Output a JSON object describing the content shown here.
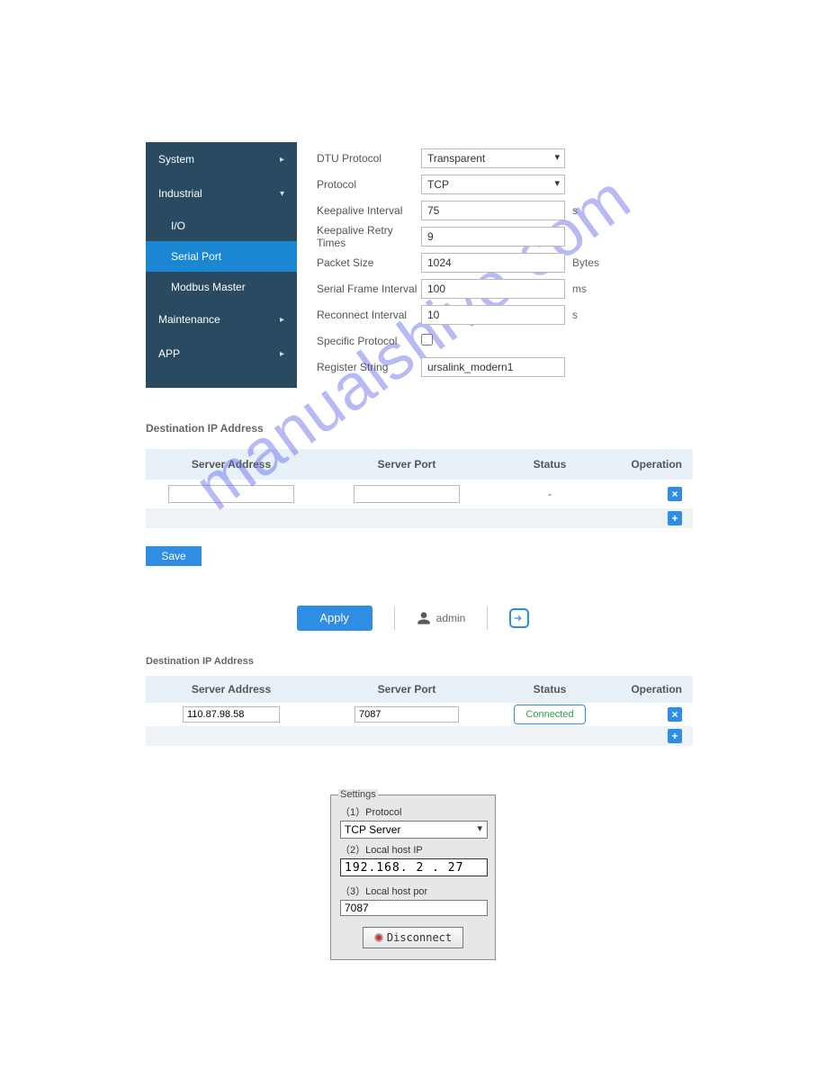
{
  "watermark": "manualshive.com",
  "sidebar": {
    "system": "System",
    "industrial": "Industrial",
    "io": "I/O",
    "serial_port": "Serial Port",
    "modbus_master": "Modbus Master",
    "maintenance": "Maintenance",
    "app": "APP"
  },
  "form": {
    "dtu_protocol_label": "DTU Protocol",
    "dtu_protocol_value": "Transparent",
    "protocol_label": "Protocol",
    "protocol_value": "TCP",
    "keepalive_interval_label": "Keepalive Interval",
    "keepalive_interval_value": "75",
    "keepalive_interval_unit": "s",
    "keepalive_retry_label": "Keepalive Retry Times",
    "keepalive_retry_value": "9",
    "packet_size_label": "Packet Size",
    "packet_size_value": "1024",
    "packet_size_unit": "Bytes",
    "serial_frame_label": "Serial Frame Interval",
    "serial_frame_value": "100",
    "serial_frame_unit": "ms",
    "reconnect_label": "Reconnect Interval",
    "reconnect_value": "10",
    "reconnect_unit": "s",
    "specific_protocol_label": "Specific Protocol",
    "register_string_label": "Register String",
    "register_string_value": "ursalink_modern1"
  },
  "dest1": {
    "title": "Destination IP Address",
    "cols": {
      "addr": "Server Address",
      "port": "Server Port",
      "stat": "Status",
      "op": "Operation"
    },
    "row": {
      "addr": "",
      "port": "",
      "stat": "-"
    },
    "save": "Save"
  },
  "bar": {
    "apply": "Apply",
    "user": "admin"
  },
  "dest2": {
    "title": "Destination IP Address",
    "cols": {
      "addr": "Server Address",
      "port": "Server Port",
      "stat": "Status",
      "op": "Operation"
    },
    "row": {
      "addr": "110.87.98.58",
      "port": "7087",
      "stat": "Connected"
    }
  },
  "settings": {
    "legend": "Settings",
    "protocol_label": "（1）Protocol",
    "protocol_value": "TCP Server",
    "host_ip_label": "（2）Local host IP",
    "host_ip_value": "192.168. 2 . 27",
    "host_port_label": "（3）Local host por",
    "host_port_value": "7087",
    "disconnect": "Disconnect"
  }
}
